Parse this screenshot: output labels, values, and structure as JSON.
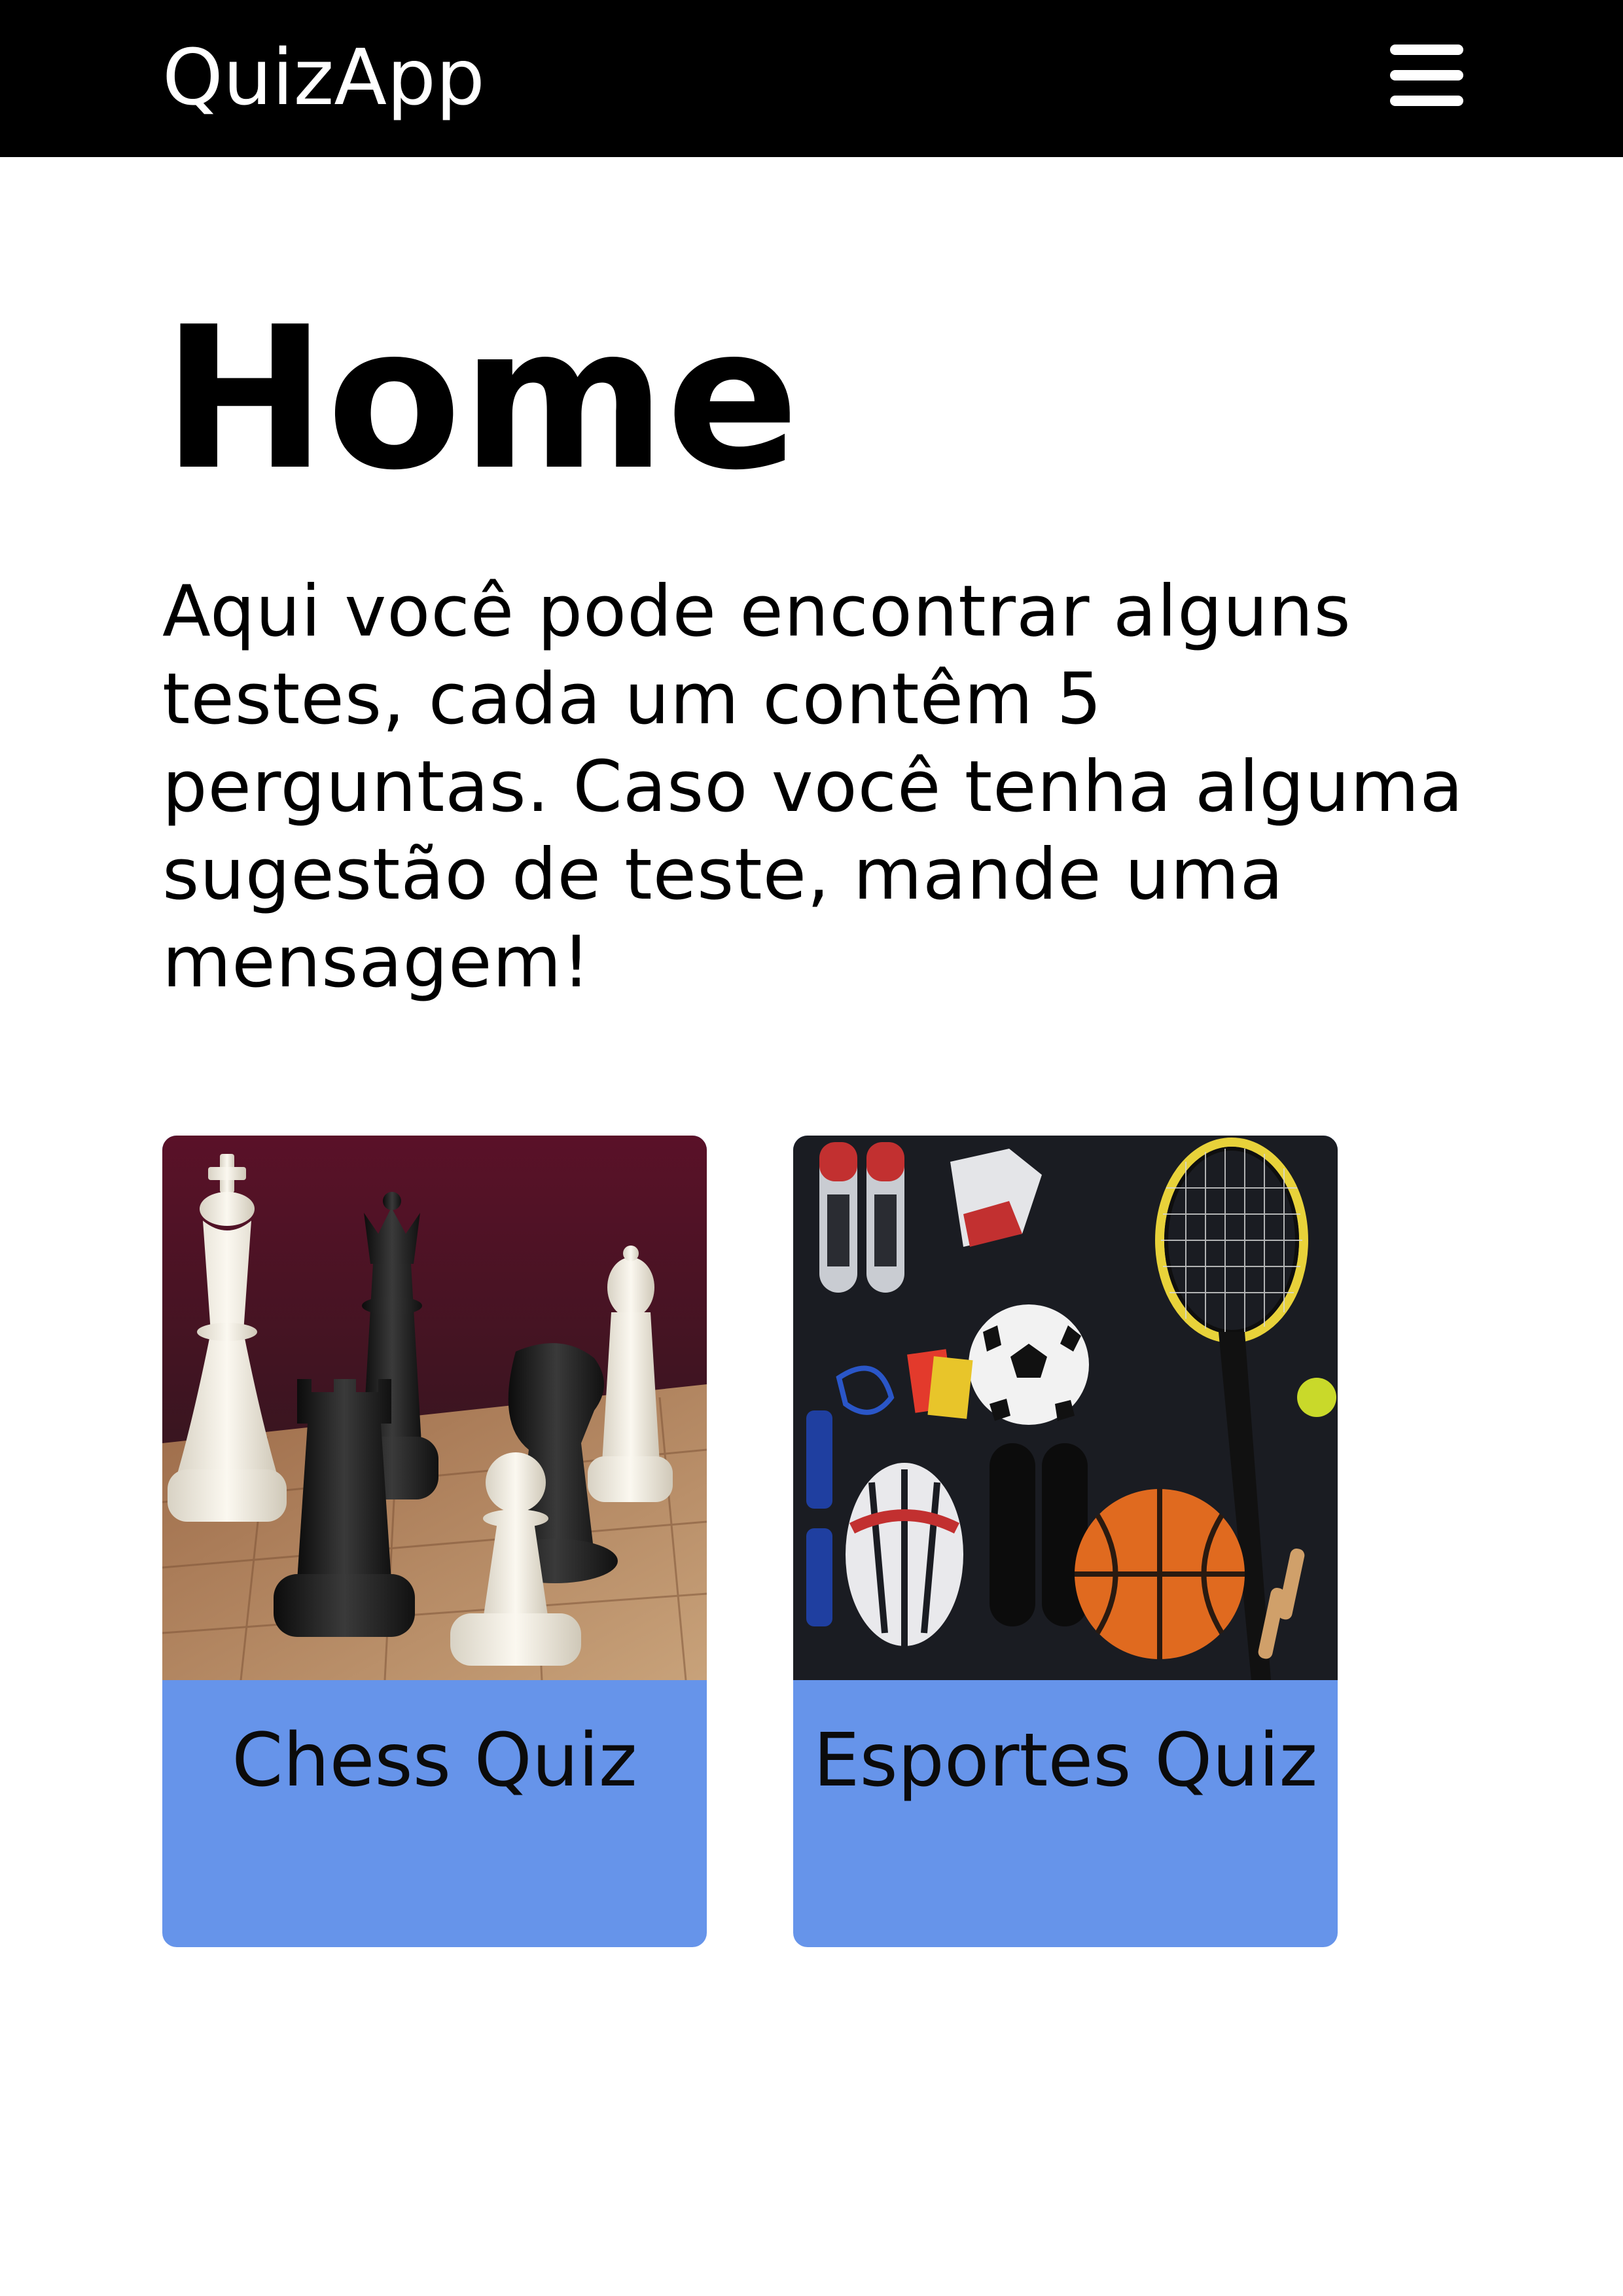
{
  "navbar": {
    "brand": "QuizApp",
    "menu_icon": "hamburger-menu-icon"
  },
  "main": {
    "title": "Home",
    "intro": "Aqui você pode encontrar alguns testes, cada um contêm 5 perguntas. Caso você tenha alguma sugestão de teste, mande uma mensagem!",
    "cards": [
      {
        "label": "Chess Quiz",
        "image": "chess-pieces-image"
      },
      {
        "label": "Esportes Quiz",
        "image": "sports-equipment-image"
      }
    ]
  },
  "colors": {
    "navbar_background": "#000000",
    "card_label_background": "#6694ea",
    "page_background": "#ffffff"
  }
}
